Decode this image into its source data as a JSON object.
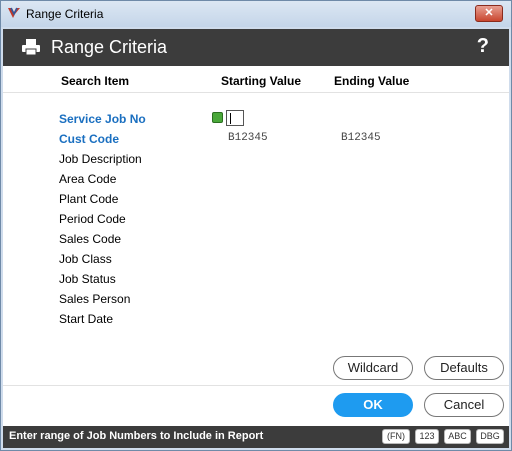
{
  "window": {
    "title": "Range Criteria",
    "close_label": "✕"
  },
  "header": {
    "title": "Range Criteria",
    "help_label": "?"
  },
  "columns": {
    "search_item": "Search Item",
    "starting_value": "Starting Value",
    "ending_value": "Ending Value"
  },
  "rows": [
    {
      "label": "Service Job No",
      "start": "",
      "end": ""
    },
    {
      "label": "Cust Code",
      "start": "B12345",
      "end": "B12345"
    },
    {
      "label": "Job Description"
    },
    {
      "label": "Area Code"
    },
    {
      "label": "Plant Code"
    },
    {
      "label": "Period Code"
    },
    {
      "label": "Sales Code"
    },
    {
      "label": "Job Class"
    },
    {
      "label": "Job Status"
    },
    {
      "label": "Sales Person"
    },
    {
      "label": "Start Date"
    }
  ],
  "buttons": {
    "wildcard": "Wildcard",
    "defaults": "Defaults",
    "ok": "OK",
    "cancel": "Cancel"
  },
  "status": {
    "text": "Enter range of Job Numbers to Include in Report",
    "badges": [
      "(FN)",
      "123",
      "ABC",
      "DBG"
    ]
  }
}
